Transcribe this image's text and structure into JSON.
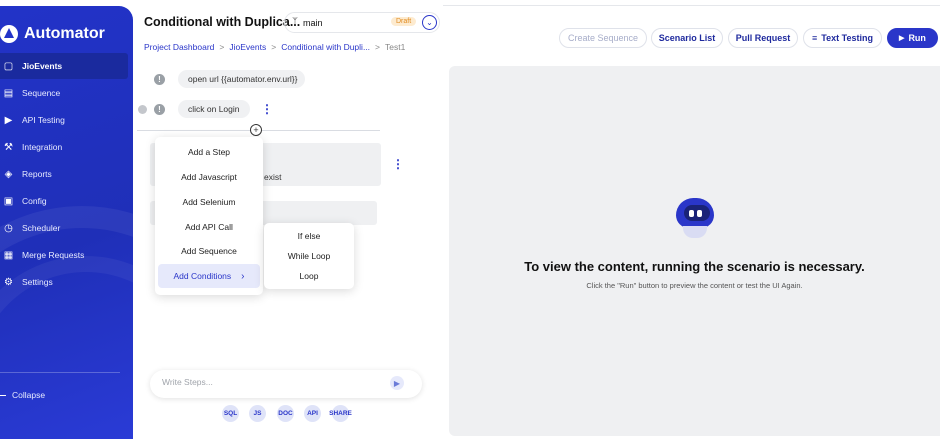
{
  "app": {
    "name": "Automator"
  },
  "sidebar": {
    "items": [
      {
        "label": "JioEvents",
        "icon": "folder-icon",
        "active": true
      },
      {
        "label": "Sequence",
        "icon": "sequence-icon"
      },
      {
        "label": "API Testing",
        "icon": "api-icon"
      },
      {
        "label": "Integration",
        "icon": "wrench-icon"
      },
      {
        "label": "Reports",
        "icon": "reports-icon"
      },
      {
        "label": "Config",
        "icon": "camera-icon"
      },
      {
        "label": "Scheduler",
        "icon": "clock-icon"
      },
      {
        "label": "Merge Requests",
        "icon": "merge-icon"
      },
      {
        "label": "Settings",
        "icon": "gear-icon"
      }
    ],
    "collapse_label": "Collapse"
  },
  "header": {
    "title": "Conditional with Duplica...",
    "branch": "main",
    "branch_status": "Draft",
    "breadcrumb": [
      "Project Dashboard",
      "JioEvents",
      "Conditional with Dupli...",
      "Test1"
    ]
  },
  "toolbar": {
    "create_sequence": "Create Sequence",
    "scenario_list": "Scenario List",
    "pull_request": "Pull Request",
    "text_testing": "Text Testing",
    "run": "Run"
  },
  "steps": [
    {
      "text": "open url {{automator.env.url}}"
    },
    {
      "text": "click on Login"
    },
    {
      "text": "exist"
    }
  ],
  "add_menu": {
    "items": [
      "Add a Step",
      "Add Javascript",
      "Add Selenium",
      "Add API Call",
      "Add Sequence",
      "Add Conditions"
    ],
    "active": "Add Conditions"
  },
  "conditions_menu": {
    "items": [
      "If else",
      "While Loop",
      "Loop"
    ]
  },
  "composer": {
    "placeholder": "Write Steps..."
  },
  "tools": [
    "SQL",
    "JS",
    "DOC",
    "API",
    "SHARE"
  ],
  "preview": {
    "title": "To view the content, running the scenario is necessary.",
    "subtitle": "Click the \"Run\" button to preview the content or test the UI Again."
  },
  "colors": {
    "accent": "#2a36c9",
    "sidebar": "#2233c8",
    "draft_bg": "#fdebd0",
    "draft_text": "#e08a1e"
  }
}
